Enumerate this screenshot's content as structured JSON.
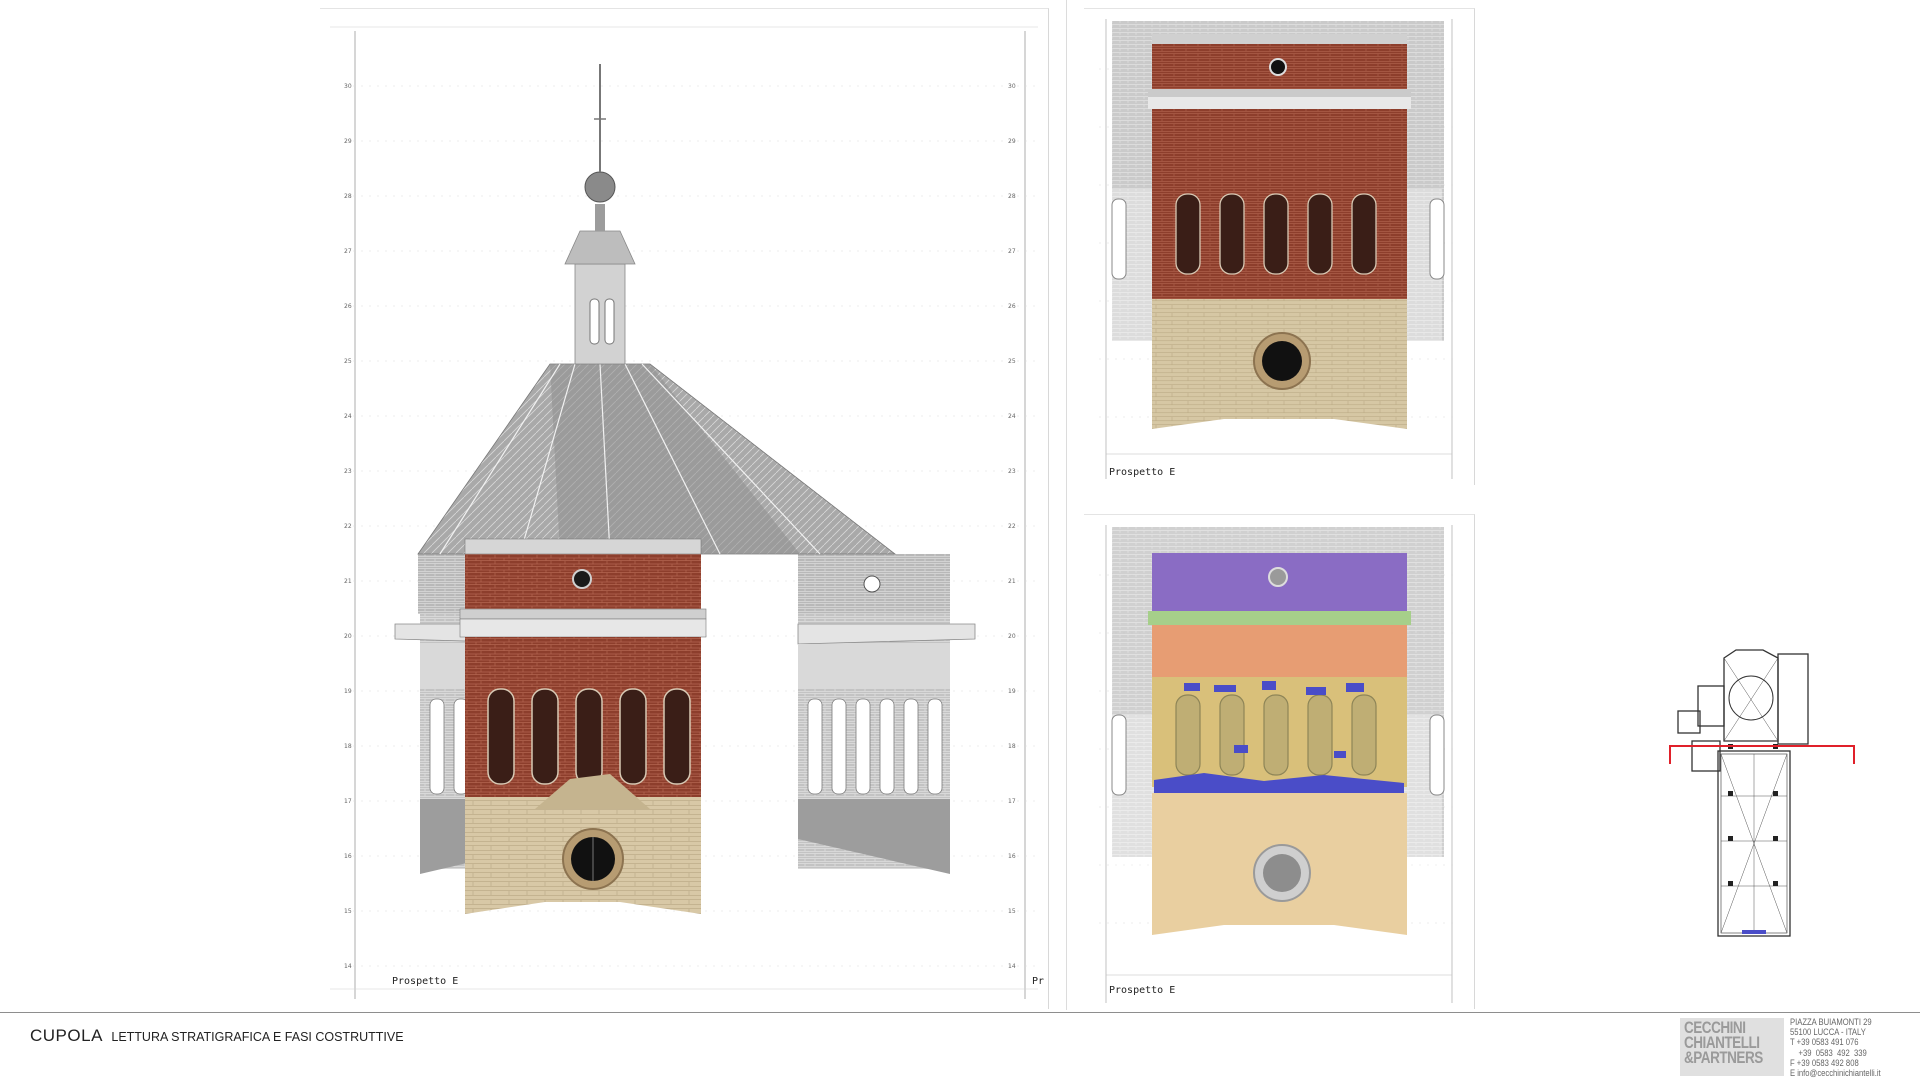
{
  "panels": {
    "main": {
      "caption": "Prospetto E",
      "edge_caption": "Pr"
    },
    "top": {
      "caption": "Prospetto E"
    },
    "bottom": {
      "caption": "Prospetto E"
    }
  },
  "level_labels": [
    "30",
    "29",
    "28",
    "27",
    "26",
    "25",
    "24",
    "23",
    "22",
    "21",
    "20",
    "19",
    "18",
    "17",
    "16",
    "15",
    "14"
  ],
  "footer": {
    "title_main": "CUPOLA",
    "title_sub": "LETTURA STRATIGRAFICA E FASI COSTRUTTIVE",
    "logo_lines": [
      "CECCHINI",
      "CHIANTELLI",
      "&PARTNERS"
    ],
    "address_lines": [
      "PIAZZA BUIAMONTI 29",
      "55100  LUCCA  -  ITALY",
      "T  +39  0583  491  076",
      "    +39  0583  492  339",
      "F  +39  0583  492  808",
      "E info@cecchinichiantelli.it"
    ]
  },
  "colors": {
    "brick": "#8a3c2a",
    "stone": "#d9c9a6",
    "phase_purple": "#8a6cc4",
    "phase_green": "#a6cf8a",
    "phase_orange": "#e79d73",
    "phase_yellow": "#d9c07a",
    "phase_beige": "#e9cfa0",
    "phase_blue": "#4a4dc8",
    "section_line": "#e0202a"
  }
}
